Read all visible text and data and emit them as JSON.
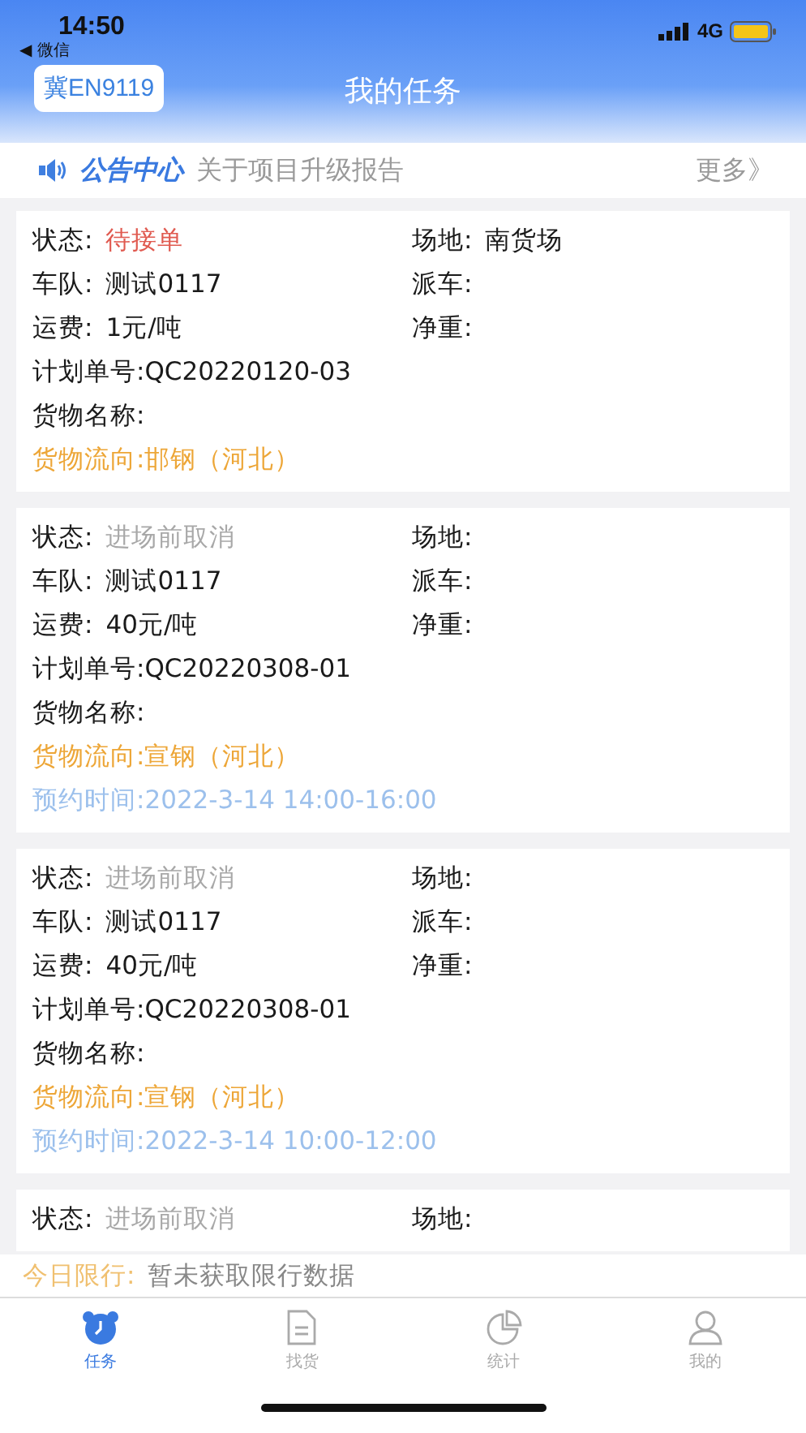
{
  "status_bar": {
    "time": "14:50",
    "back_app": "◀ 微信",
    "network": "4G"
  },
  "header": {
    "plate": "冀EN9119",
    "title": "我的任务"
  },
  "notice": {
    "label": "公告中心",
    "text": "关于项目升级报告",
    "more": "更多》"
  },
  "tasks": [
    {
      "status_label": "状态:",
      "status": "待接单",
      "color": "#e05a50",
      "site_label": "场地:",
      "site": "南货场",
      "team_label": "车队:",
      "team": "测试0117",
      "dispatch_label": "派车:",
      "fee_label": "运费:",
      "fee": "1元/吨",
      "weight_label": "净重:",
      "plan": "计划单号:QC20220120-03",
      "goods": "货物名称:",
      "flow": "货物流向:邯钢（河北）"
    },
    {
      "status_label": "状态:",
      "status": "进场前取消",
      "color": "#a8a8a8",
      "site_label": "场地:",
      "team_label": "车队:",
      "team": "测试0117",
      "dispatch_label": "派车:",
      "fee_label": "运费:",
      "fee": "40元/吨",
      "weight_label": "净重:",
      "plan": "计划单号:QC20220308-01",
      "goods": "货物名称:",
      "flow": "货物流向:宣钢（河北）",
      "appointment": "预约时间:2022-3-14 14:00-16:00"
    },
    {
      "status_label": "状态:",
      "status": "进场前取消",
      "color": "#a8a8a8",
      "site_label": "场地:",
      "team_label": "车队:",
      "team": "测试0117",
      "dispatch_label": "派车:",
      "fee_label": "运费:",
      "fee": "40元/吨",
      "weight_label": "净重:",
      "plan": "计划单号:QC20220308-01",
      "goods": "货物名称:",
      "flow": "货物流向:宣钢（河北）",
      "appointment": "预约时间:2022-3-14 10:00-12:00"
    },
    {
      "status_label": "状态:",
      "status": "进场前取消",
      "color": "#a8a8a8",
      "site_label": "场地:"
    }
  ],
  "limit": {
    "label": "今日限行:",
    "text": "暂未获取限行数据"
  },
  "tabs": [
    {
      "label": "任务",
      "selected": true
    },
    {
      "label": "找货",
      "selected": false
    },
    {
      "label": "统计",
      "selected": false
    },
    {
      "label": "我的",
      "selected": false
    }
  ]
}
